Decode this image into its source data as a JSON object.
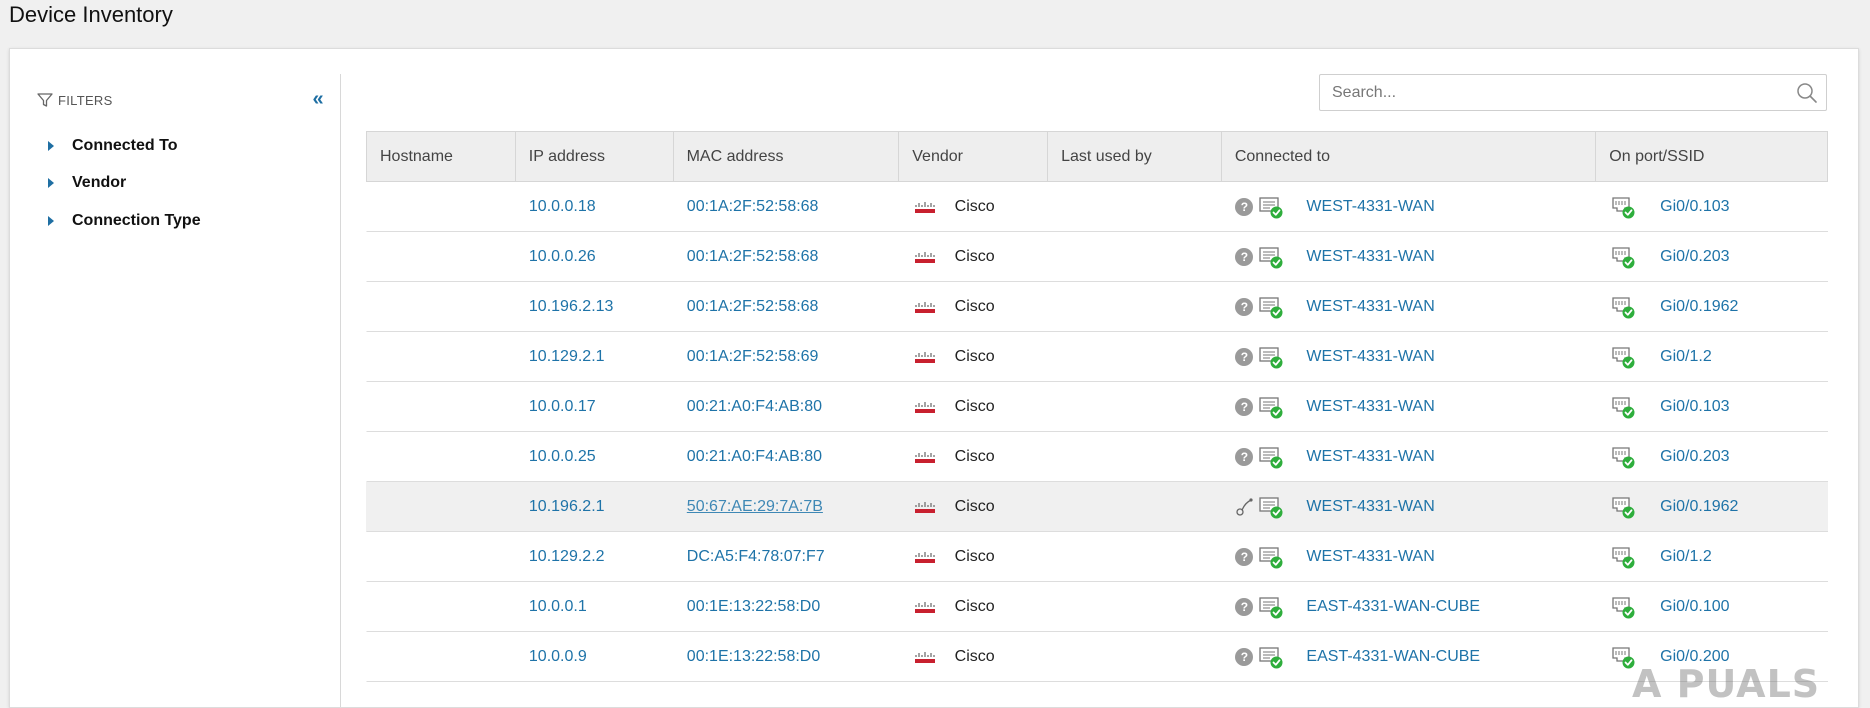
{
  "page": {
    "title": "Device Inventory"
  },
  "filters": {
    "header": "FILTERS",
    "collapse_glyph": "«",
    "items": [
      {
        "label": "Connected To"
      },
      {
        "label": "Vendor"
      },
      {
        "label": "Connection Type"
      }
    ]
  },
  "search": {
    "placeholder": "Search..."
  },
  "table": {
    "columns": [
      "Hostname",
      "IP address",
      "MAC address",
      "Vendor",
      "Last used by",
      "Connected to",
      "On port/SSID"
    ],
    "rows": [
      {
        "hostname": "",
        "ip": "10.0.0.18",
        "mac": "00:1A:2F:52:58:68",
        "vendor": "Cisco",
        "last_used_by": "",
        "connected_to": "WEST-4331-WAN",
        "port": "Gi0/0.103",
        "conn_type": "unknown"
      },
      {
        "hostname": "",
        "ip": "10.0.0.26",
        "mac": "00:1A:2F:52:58:68",
        "vendor": "Cisco",
        "last_used_by": "",
        "connected_to": "WEST-4331-WAN",
        "port": "Gi0/0.203",
        "conn_type": "unknown"
      },
      {
        "hostname": "",
        "ip": "10.196.2.13",
        "mac": "00:1A:2F:52:58:68",
        "vendor": "Cisco",
        "last_used_by": "",
        "connected_to": "WEST-4331-WAN",
        "port": "Gi0/0.1962",
        "conn_type": "unknown"
      },
      {
        "hostname": "",
        "ip": "10.129.2.1",
        "mac": "00:1A:2F:52:58:69",
        "vendor": "Cisco",
        "last_used_by": "",
        "connected_to": "WEST-4331-WAN",
        "port": "Gi0/1.2",
        "conn_type": "unknown"
      },
      {
        "hostname": "",
        "ip": "10.0.0.17",
        "mac": "00:21:A0:F4:AB:80",
        "vendor": "Cisco",
        "last_used_by": "",
        "connected_to": "WEST-4331-WAN",
        "port": "Gi0/0.103",
        "conn_type": "unknown"
      },
      {
        "hostname": "",
        "ip": "10.0.0.25",
        "mac": "00:21:A0:F4:AB:80",
        "vendor": "Cisco",
        "last_used_by": "",
        "connected_to": "WEST-4331-WAN",
        "port": "Gi0/0.203",
        "conn_type": "unknown"
      },
      {
        "hostname": "",
        "ip": "10.196.2.1",
        "mac": "50:67:AE:29:7A:7B",
        "vendor": "Cisco",
        "last_used_by": "",
        "connected_to": "WEST-4331-WAN",
        "port": "Gi0/0.1962",
        "conn_type": "link",
        "hovered": true
      },
      {
        "hostname": "",
        "ip": "10.129.2.2",
        "mac": "DC:A5:F4:78:07:F7",
        "vendor": "Cisco",
        "last_used_by": "",
        "connected_to": "WEST-4331-WAN",
        "port": "Gi0/1.2",
        "conn_type": "unknown"
      },
      {
        "hostname": "",
        "ip": "10.0.0.1",
        "mac": "00:1E:13:22:58:D0",
        "vendor": "Cisco",
        "last_used_by": "",
        "connected_to": "EAST-4331-WAN-CUBE",
        "port": "Gi0/0.100",
        "conn_type": "unknown"
      },
      {
        "hostname": "",
        "ip": "10.0.0.9",
        "mac": "00:1E:13:22:58:D0",
        "vendor": "Cisco",
        "last_used_by": "",
        "connected_to": "EAST-4331-WAN-CUBE",
        "port": "Gi0/0.200",
        "conn_type": "unknown"
      }
    ]
  },
  "watermark": {
    "text": "A PUALS"
  },
  "colors": {
    "link": "#1e73a8",
    "accent": "#1f6fa3",
    "status_ok": "#2eae3c",
    "cisco_red": "#c8202f",
    "header_bg": "#eeeeee"
  }
}
